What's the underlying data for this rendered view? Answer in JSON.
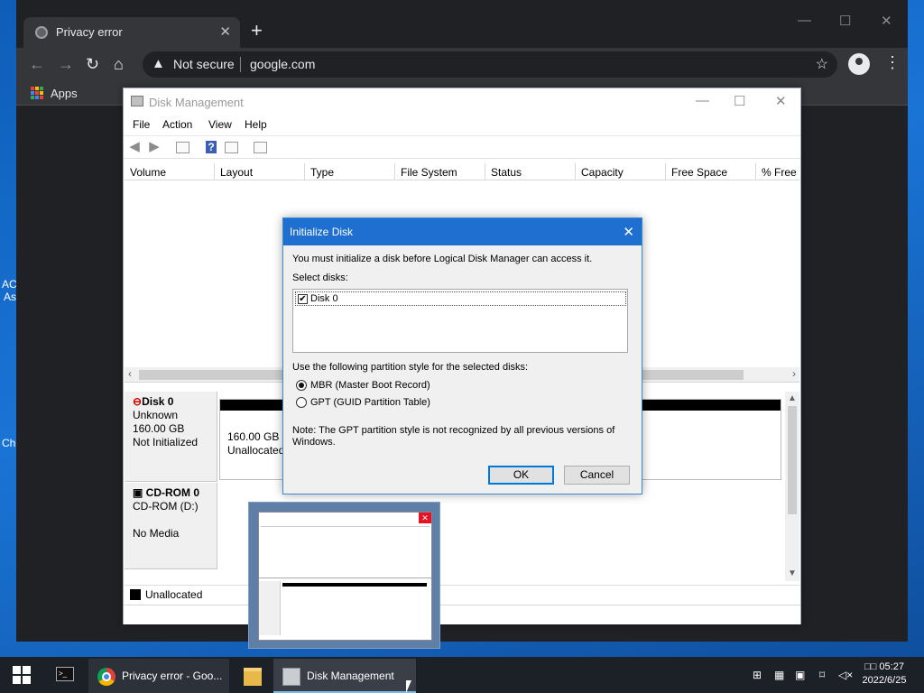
{
  "desktop": {
    "edge_text": [
      "AC",
      "As",
      "Ch"
    ]
  },
  "browser": {
    "tab_title": "Privacy error",
    "new_tab": "+",
    "security_label": "Not secure",
    "url": "google.com",
    "bookmarks_apps": "Apps",
    "controls": {
      "minimize": "—",
      "maximize": "☐",
      "close": "✕"
    }
  },
  "disk_mgmt": {
    "title": "Disk Management",
    "menu": [
      "File",
      "Action",
      "View",
      "Help"
    ],
    "columns": [
      "Volume",
      "Layout",
      "Type",
      "File System",
      "Status",
      "Capacity",
      "Free Space",
      "% Free"
    ],
    "disk0": {
      "name": "Disk 0",
      "type": "Unknown",
      "size": "160.00 GB",
      "state": "Not Initialized",
      "partition_size": "160.00 GB",
      "partition_label": "Unallocated"
    },
    "cdrom": {
      "name": "CD-ROM 0",
      "type": "CD-ROM (D:)",
      "media": "No Media"
    },
    "legend": "Unallocated"
  },
  "dialog": {
    "title": "Initialize Disk",
    "message": "You must initialize a disk before Logical Disk Manager can access it.",
    "select_label": "Select disks:",
    "disks": [
      {
        "label": "Disk 0",
        "checked": true
      }
    ],
    "style_label": "Use the following partition style for the selected disks:",
    "options": [
      {
        "label": "MBR (Master Boot Record)",
        "selected": true
      },
      {
        "label": "GPT (GUID Partition Table)",
        "selected": false
      }
    ],
    "note_line1": "Note: The GPT partition style is not recognized by all previous versions of",
    "note_line2": "Windows.",
    "ok": "OK",
    "cancel": "Cancel"
  },
  "taskbar": {
    "chrome_label": "Privacy error - Goo...",
    "diskmgmt_label": "Disk Management",
    "time": "05:27",
    "time_prefix": "□□",
    "date": "2022/6/25"
  }
}
